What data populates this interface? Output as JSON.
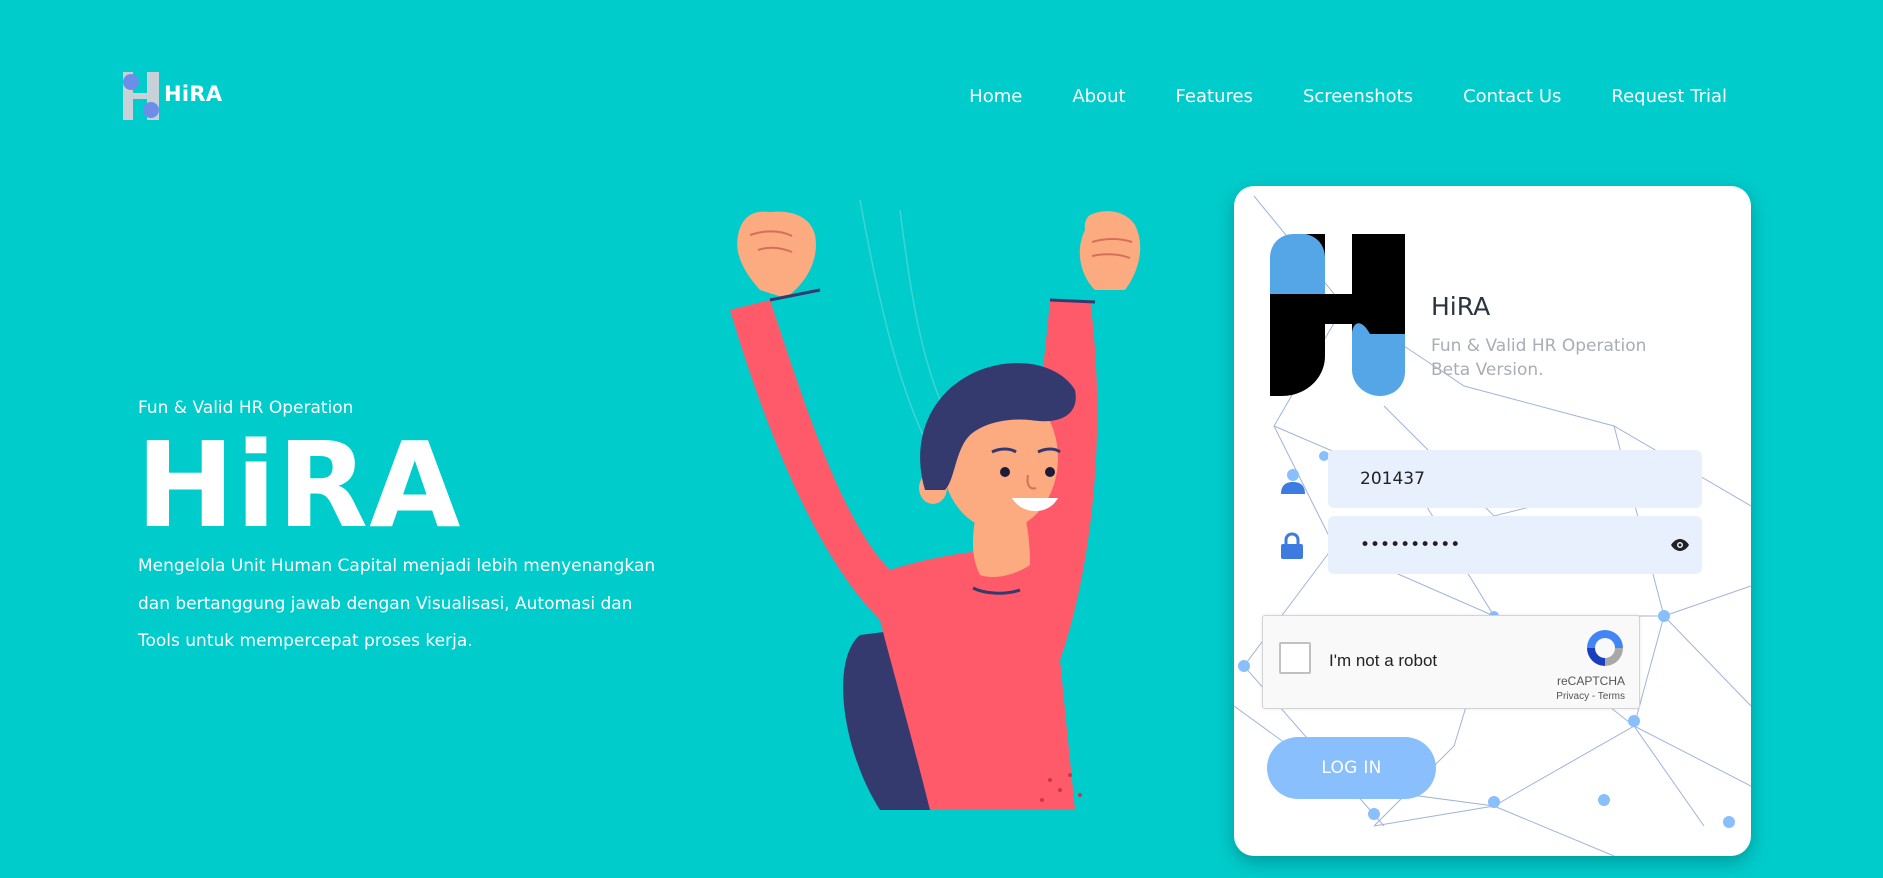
{
  "brand": {
    "name": "HiRA"
  },
  "nav": {
    "items": [
      {
        "label": "Home"
      },
      {
        "label": "About"
      },
      {
        "label": "Features"
      },
      {
        "label": "Screenshots"
      },
      {
        "label": "Contact Us"
      },
      {
        "label": "Request Trial"
      }
    ]
  },
  "hero": {
    "subtitle": "Fun & Valid HR Operation",
    "title": "HiRA",
    "description_lines": [
      "Mengelola Unit Human Capital menjadi lebih menyenangkan",
      "dan bertanggung jawab dengan Visualisasi, Automasi dan",
      "Tools untuk mempercepat proses kerja."
    ]
  },
  "login": {
    "app_name": "HiRA",
    "tagline_lines": [
      "Fun & Valid HR Operation",
      "Beta Version."
    ],
    "username_value": "201437",
    "password_value": "••••••••••",
    "recaptcha": {
      "label": "I'm not a robot",
      "brand": "reCAPTCHA",
      "links": "Privacy - Terms"
    },
    "submit_label": "LOG IN"
  },
  "colors": {
    "background": "#00cccc",
    "logo_blue": "#55a6e6",
    "button": "#88bffc",
    "field_bg": "#e8f0fe",
    "shirt": "#ff5a6a",
    "hair": "#343a6e",
    "skin": "#fcaa80"
  },
  "icons": [
    "user-icon",
    "lock-icon",
    "eye-icon",
    "recaptcha-icon",
    "hira-logo-icon"
  ]
}
